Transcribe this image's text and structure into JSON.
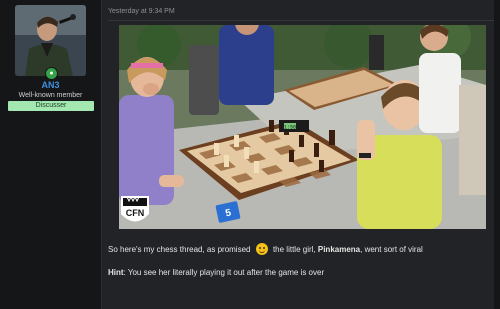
{
  "user": {
    "name": "AN3",
    "title": "Well-known member",
    "banner": "Discusser"
  },
  "post": {
    "date": "Yesterday at 9:34 PM",
    "line1_prefix": "So here's my chess thread, as promised",
    "line1_middle": "the little girl,",
    "line1_name": "Pinkamena",
    "line1_suffix": "went sort of viral",
    "hint_label": "Hint",
    "hint_text": ": You see her literally playing it out after the game is over"
  },
  "photo": {
    "logo_text": "CFN",
    "clock_text": "1:58",
    "card_number": "5"
  },
  "icons": {
    "smiley": "smiley-emoji-icon",
    "online": "online-status-icon"
  }
}
